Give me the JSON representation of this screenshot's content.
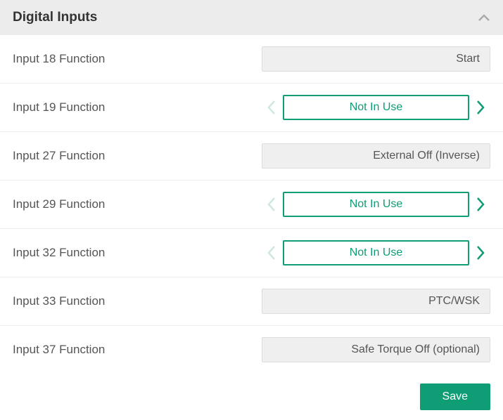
{
  "header": {
    "title": "Digital Inputs"
  },
  "rows": [
    {
      "label": "Input 18 Function",
      "value": "Start",
      "editable": false
    },
    {
      "label": "Input 19 Function",
      "value": "Not In Use",
      "editable": true
    },
    {
      "label": "Input 27 Function",
      "value": "External Off (Inverse)",
      "editable": false
    },
    {
      "label": "Input 29 Function",
      "value": "Not In Use",
      "editable": true
    },
    {
      "label": "Input 32 Function",
      "value": "Not In Use",
      "editable": true
    },
    {
      "label": "Input 33 Function",
      "value": "PTC/WSK",
      "editable": false
    },
    {
      "label": "Input 37 Function",
      "value": "Safe Torque Off (optional)",
      "editable": false
    }
  ],
  "footer": {
    "save_label": "Save"
  }
}
